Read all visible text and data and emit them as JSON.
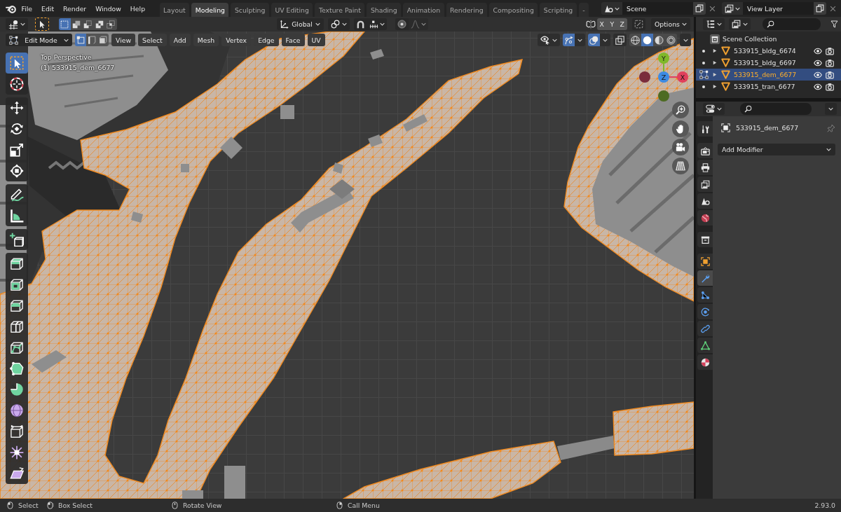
{
  "top_bar": {
    "menus": [
      "File",
      "Edit",
      "Render",
      "Window",
      "Help"
    ],
    "workspaces": [
      {
        "label": "Layout",
        "selected": false
      },
      {
        "label": "Modeling",
        "selected": true
      },
      {
        "label": "Sculpting",
        "selected": false
      },
      {
        "label": "UV Editing",
        "selected": false
      },
      {
        "label": "Texture Paint",
        "selected": false
      },
      {
        "label": "Shading",
        "selected": false
      },
      {
        "label": "Animation",
        "selected": false
      },
      {
        "label": "Rendering",
        "selected": false
      },
      {
        "label": "Compositing",
        "selected": false
      },
      {
        "label": "Scripting",
        "selected": false
      },
      {
        "label": "-",
        "selected": false
      }
    ],
    "scene": "Scene",
    "view_layer": "View Layer"
  },
  "tool_settings": {
    "select_modes": [
      {
        "kind": "set",
        "selected": true
      },
      {
        "kind": "extend",
        "selected": false
      },
      {
        "kind": "subtract",
        "selected": false
      },
      {
        "kind": "difference",
        "selected": false
      },
      {
        "kind": "intersect",
        "selected": false
      }
    ],
    "orientation": "Global",
    "snap_on": false,
    "proportional_on": false,
    "mirror": [
      {
        "label": "X",
        "on": false
      },
      {
        "label": "Y",
        "on": false
      },
      {
        "label": "Z",
        "on": false
      }
    ],
    "options": "Options"
  },
  "outliner": {
    "root": "Scene Collection",
    "items": [
      {
        "name": "533915_bldg_6674",
        "selected": false,
        "editing": false
      },
      {
        "name": "533915_bldg_6697",
        "selected": false,
        "editing": false
      },
      {
        "name": "533915_dem_6677",
        "selected": true,
        "editing": true
      },
      {
        "name": "533915_tran_6677",
        "selected": false,
        "editing": false
      }
    ]
  },
  "viewport_header": {
    "mode": "Edit Mode",
    "select_modes": [
      {
        "kind": "vertex",
        "selected": true
      },
      {
        "kind": "edge",
        "selected": false
      },
      {
        "kind": "face",
        "selected": false
      }
    ],
    "menus": [
      "View",
      "Select",
      "Add",
      "Mesh",
      "Vertex",
      "Edge",
      "Face",
      "UV"
    ],
    "gizmos_on": true,
    "overlays_on": true,
    "xray_on": false,
    "shading": [
      {
        "kind": "wireframe",
        "selected": false
      },
      {
        "kind": "solid",
        "selected": true
      },
      {
        "kind": "material",
        "selected": false
      },
      {
        "kind": "rendered",
        "selected": false
      }
    ]
  },
  "viewport": {
    "view_name": "Top Perspective",
    "object_info": "(1) 533915_dem_6677",
    "axes": [
      {
        "kind": "neg_x",
        "color": "#7a2c3c"
      },
      {
        "kind": "neg_y",
        "color": "#4d6b22"
      },
      {
        "kind": "pos_y",
        "label": "Y",
        "color": "#80b82a"
      },
      {
        "kind": "pos_x",
        "label": "X",
        "color": "#e0405c"
      },
      {
        "kind": "pos_z",
        "label": "Z",
        "color": "#3d8be3"
      }
    ],
    "nav_buttons": [
      {
        "kind": "zoom"
      },
      {
        "kind": "pan"
      },
      {
        "kind": "camera"
      },
      {
        "kind": "ortho"
      }
    ]
  },
  "toolbar": {
    "groups": [
      {
        "tools": [
          {
            "kind": "select_box",
            "selected": true
          },
          {
            "kind": "cursor",
            "selected": false
          }
        ]
      },
      {
        "tools": [
          {
            "kind": "move",
            "selected": false
          },
          {
            "kind": "rotate",
            "selected": false
          },
          {
            "kind": "scale",
            "selected": false
          },
          {
            "kind": "transform",
            "selected": false
          }
        ]
      },
      {
        "tools": [
          {
            "kind": "annotate",
            "selected": false
          },
          {
            "kind": "measure",
            "selected": false
          }
        ]
      },
      {
        "tools": [
          {
            "kind": "add_cube",
            "selected": false
          }
        ]
      },
      {
        "tools": [
          {
            "kind": "extrude",
            "selected": false
          },
          {
            "kind": "inset",
            "selected": false
          },
          {
            "kind": "bevel",
            "selected": false
          },
          {
            "kind": "loop_cut",
            "selected": false
          },
          {
            "kind": "knife",
            "selected": false
          },
          {
            "kind": "poly_build",
            "selected": false
          },
          {
            "kind": "spin",
            "selected": false
          },
          {
            "kind": "smooth",
            "selected": false
          },
          {
            "kind": "edge_slide",
            "selected": false
          },
          {
            "kind": "shrink_fatten",
            "selected": false
          },
          {
            "kind": "shear",
            "selected": false
          }
        ]
      }
    ]
  },
  "properties": {
    "tab_groups": [
      {
        "tabs": [
          {
            "kind": "tool",
            "selected": false
          }
        ]
      },
      {
        "tabs": [
          {
            "kind": "render",
            "selected": false
          },
          {
            "kind": "output",
            "selected": false
          },
          {
            "kind": "view_layer",
            "selected": false
          },
          {
            "kind": "scene",
            "selected": false
          },
          {
            "kind": "world",
            "selected": false
          }
        ]
      },
      {
        "tabs": [
          {
            "kind": "collection",
            "selected": false
          }
        ]
      },
      {
        "tabs": [
          {
            "kind": "object",
            "selected": false
          },
          {
            "kind": "modifiers",
            "selected": true
          },
          {
            "kind": "particles",
            "selected": false
          },
          {
            "kind": "physics",
            "selected": false
          },
          {
            "kind": "constraints",
            "selected": false
          },
          {
            "kind": "data",
            "selected": false
          },
          {
            "kind": "material",
            "selected": false
          }
        ]
      }
    ],
    "object_name": "533915_dem_6677",
    "add_modifier": "Add Modifier"
  },
  "status_bar": {
    "hints": [
      {
        "kind": "left",
        "label": "Select"
      },
      {
        "kind": "left_drag",
        "label": "Box Select"
      },
      {
        "kind": "middle",
        "label": "Rotate View"
      },
      {
        "kind": "right",
        "label": "Call Menu"
      }
    ],
    "version": "2.93.0"
  }
}
